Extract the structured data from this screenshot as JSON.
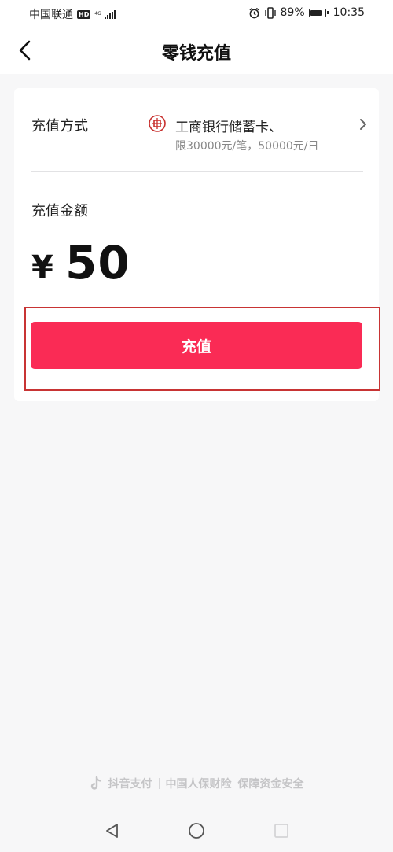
{
  "status_bar": {
    "carrier": "中国联通",
    "hd_badge": "HD",
    "network": "4G",
    "battery_percent_text": "89%",
    "battery_level": 0.89,
    "time": "10:35"
  },
  "header": {
    "title": "零钱充值"
  },
  "payment_method": {
    "label": "充值方式",
    "bank_name": "工商银行储蓄卡",
    "card_suffix": "、",
    "limit_text": "限30000元/笔，50000元/日"
  },
  "amount": {
    "label": "充值金额",
    "currency": "¥",
    "value": "50"
  },
  "recharge_button": {
    "label": "充值"
  },
  "footer": {
    "brand": "抖音支付",
    "partner": "中国人保财险",
    "guarantee": "保障资金安全"
  },
  "colors": {
    "accent": "#fa2b55",
    "highlight_border": "#c83434",
    "bank_icon": "#c8312f"
  },
  "icons": {
    "back": "chevron-left-icon",
    "bank": "icbc-bank-icon",
    "chevron": "chevron-right-icon",
    "tiktok": "tiktok-icon",
    "nav_back": "nav-back-icon",
    "nav_home": "nav-home-icon",
    "nav_recent": "nav-recent-icon"
  }
}
